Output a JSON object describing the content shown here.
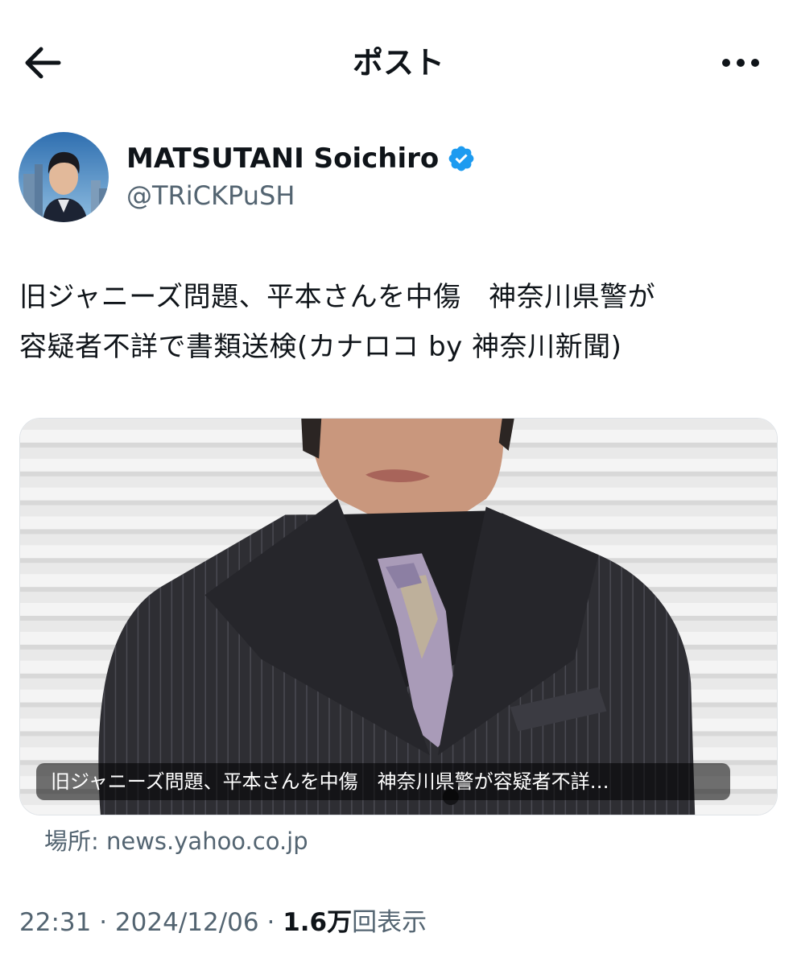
{
  "header": {
    "title": "ポスト",
    "back_icon": "arrow-left-icon",
    "more_icon": "more-horizontal-icon"
  },
  "author": {
    "display_name": "MATSUTANI Soichiro",
    "handle": "@TRiCKPuSH",
    "verified": true,
    "verified_color": "#1d9bf0"
  },
  "tweet": {
    "text_line1": "旧ジャニーズ問題、平本さんを中傷　神奈川県警が",
    "text_line2": "容疑者不詳で書類送検(カナロコ by 神奈川新聞)"
  },
  "card": {
    "caption": "旧ジャニーズ問題、平本さんを中傷　神奈川県警が容疑者不詳…",
    "source": "場所: news.yahoo.co.jp"
  },
  "meta": {
    "time": "22:31",
    "separator": "·",
    "date": "2024/12/06",
    "views_count": "1.6万",
    "views_label": "回表示"
  },
  "colors": {
    "text": "#0f1419",
    "secondary": "#536471",
    "accent": "#1d9bf0"
  }
}
